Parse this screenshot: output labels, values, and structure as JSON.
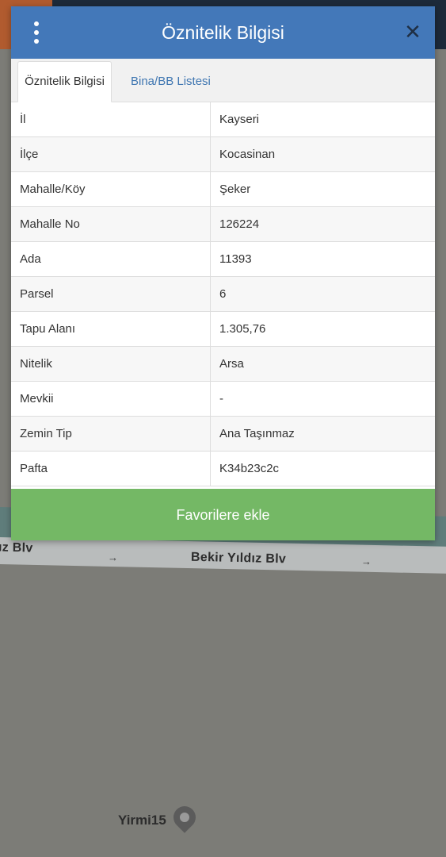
{
  "dialog": {
    "title": "Öznitelik Bilgisi",
    "tabs": [
      {
        "label": "Öznitelik Bilgisi",
        "active": true
      },
      {
        "label": "Bina/BB Listesi",
        "active": false
      }
    ],
    "rows": [
      {
        "key": "İl",
        "value": "Kayseri"
      },
      {
        "key": "İlçe",
        "value": "Kocasinan"
      },
      {
        "key": "Mahalle/Köy",
        "value": "Şeker"
      },
      {
        "key": "Mahalle No",
        "value": "126224"
      },
      {
        "key": "Ada",
        "value": "11393"
      },
      {
        "key": "Parsel",
        "value": "6"
      },
      {
        "key": "Tapu Alanı",
        "value": "1.305,76"
      },
      {
        "key": "Nitelik",
        "value": "Arsa"
      },
      {
        "key": "Mevkii",
        "value": "-"
      },
      {
        "key": "Zemin Tip",
        "value": "Ana Taşınmaz"
      },
      {
        "key": "Pafta",
        "value": "K34b23c2c"
      }
    ],
    "favorite_button": "Favorilere ekle",
    "close_icon": "✕"
  },
  "map": {
    "road_label_left": "ız Blv",
    "road_label_right": "Bekir Yıldız Blv",
    "poi_label": "Yirmi15",
    "arrow": "→"
  },
  "colors": {
    "header": "#4378b9",
    "button": "#74b865",
    "tab_link": "#3f76b1"
  }
}
